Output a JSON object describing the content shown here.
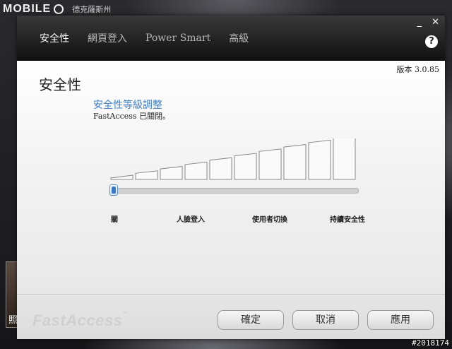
{
  "watermarks": {
    "top_logo": "MOBILE",
    "top_sub": "德克薩斯州",
    "bottom_id": "#2018174",
    "left_thumb_label": "照"
  },
  "window": {
    "controls": {
      "minimize": "_",
      "close": "✕"
    },
    "nav": [
      {
        "label": "安全性",
        "active": true
      },
      {
        "label": "網頁登入",
        "active": false
      },
      {
        "label": "Power Smart",
        "active": false
      },
      {
        "label": "高級",
        "active": false
      }
    ],
    "help_label": "?"
  },
  "content": {
    "version": "版本 3.0.85",
    "page_title": "安全性",
    "section_title": "安全性等級調整",
    "status": "FastAccess 已關閉。",
    "slider": {
      "levels": [
        "關",
        "人臉登入",
        "使用者切換",
        "持續安全性"
      ],
      "selected_index": 0
    },
    "bar_count": 10
  },
  "footer": {
    "brand": "FastAccess",
    "brand_tm": "™",
    "buttons": {
      "ok": "確定",
      "cancel": "取消",
      "apply": "應用"
    }
  },
  "colors": {
    "accent": "#3f7fc2",
    "header_bg": "#222222",
    "content_bg": "#f4f4f4"
  }
}
